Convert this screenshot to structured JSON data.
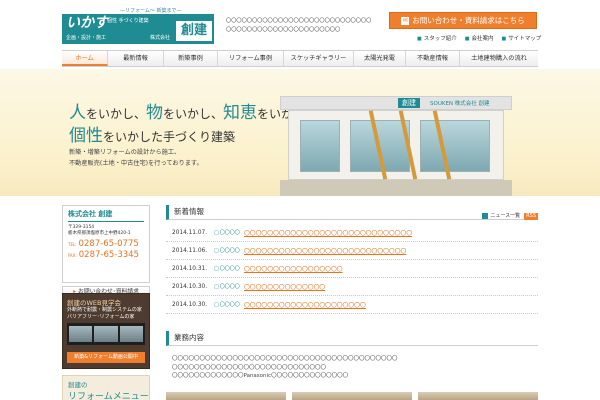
{
  "header": {
    "logo_tag": "—リフォーム〜 新築まで—",
    "logo_hira": "いかす",
    "logo_small": "個性  手づくり建築",
    "logo_sub": "企画・設計・施工",
    "logo_company": "株式会社",
    "logo_kanji": "創建",
    "intro": "〇〇〇〇〇〇〇〇〇〇〇〇〇〇〇〇〇〇〇〇〇〇〇〇〇〇〇〇〇〇〇〇〇〇〇〇〇〇〇〇〇〇〇〇〇〇〇〇〇〇",
    "contact_button": "お問い合わせ・資料請求はこちら",
    "sub_links": [
      "スタッフ紹介",
      "会社案内",
      "サイトマップ"
    ]
  },
  "nav": {
    "items": [
      "ホーム",
      "最新情報",
      "新築事例",
      "リフォーム事例",
      "スケッチギャラリー",
      "太陽光発電",
      "不動産情報",
      "土地建物購入の流れ"
    ]
  },
  "hero": {
    "line1_a": "人",
    "line1_b": "をいかし、",
    "line1_c": "物",
    "line1_d": "をいかし、",
    "line1_e": "知恵",
    "line1_f": "をいかし、",
    "line2_a": "個性",
    "line2_b": "をいかした手づくり建築",
    "desc1": "新築・増築リフォームの設計から施工、",
    "desc2": "不動産販売(土地・中古住宅)を行っております。",
    "sign": "創建",
    "sign_text": "SOUKEN  株式会社 創建"
  },
  "sidebar": {
    "company_name": "株式会社 創建",
    "zip": "〒329-3154",
    "address": "栃木県那須塩原市上中野420-1",
    "tel_label": "TEL:",
    "tel": "0287-65-0775",
    "fax_label": "FAX:",
    "fax": "0287-65-3345",
    "contact_link": "お問い合わせ･資料請求",
    "tour_title": "創建のWEB見学会",
    "tour_line1": "外断熱で耐震・制震システムの家",
    "tour_line2": "バリアフリー･リフォームの家",
    "tour_button": "新築&リフォーム動画公開中",
    "menu_t1": "創建の",
    "menu_t2": "リフォームメニュー"
  },
  "news": {
    "heading": "新着情報",
    "all_link": "ニュース一覧",
    "rss": "RSS",
    "items": [
      {
        "date": "2014.11.07.",
        "cat": "〇〇〇〇",
        "title": "〇〇〇〇〇〇〇〇〇〇〇〇〇〇〇〇〇〇〇〇〇〇〇〇〇〇〇〇〇"
      },
      {
        "date": "2014.11.06.",
        "cat": "〇〇〇〇",
        "title": "〇〇〇〇〇〇〇〇〇〇〇〇〇〇〇〇〇〇〇〇〇〇〇〇〇〇〇〇"
      },
      {
        "date": "2014.10.31.",
        "cat": "〇〇〇〇",
        "title": "〇〇〇〇〇〇〇〇〇〇〇〇〇〇〇〇〇"
      },
      {
        "date": "2014.10.30.",
        "cat": "〇〇〇〇",
        "title": "〇〇〇〇〇〇〇〇〇〇〇〇〇〇"
      },
      {
        "date": "2014.10.30.",
        "cat": "〇〇〇〇",
        "title": "〇〇〇〇〇〇〇〇〇〇〇〇〇〇〇〇〇〇〇〇〇"
      }
    ]
  },
  "business": {
    "heading": "業務内容",
    "line1": "〇〇〇〇〇〇〇〇〇〇〇〇〇〇〇〇〇〇〇〇〇〇〇〇〇〇〇〇〇〇〇〇〇〇〇〇〇〇〇〇〇",
    "line2": "〇〇〇〇〇〇〇〇〇〇〇〇〇〇〇〇〇〇〇〇〇〇〇〇〇〇〇〇",
    "line3": "〇〇〇〇〇〇〇〇〇〇〇〇〇Panasonic〇〇〇〇〇〇〇〇〇〇〇〇〇〇"
  },
  "colors": {
    "accent": "#ef7f2d",
    "brand": "#1f8c93"
  }
}
